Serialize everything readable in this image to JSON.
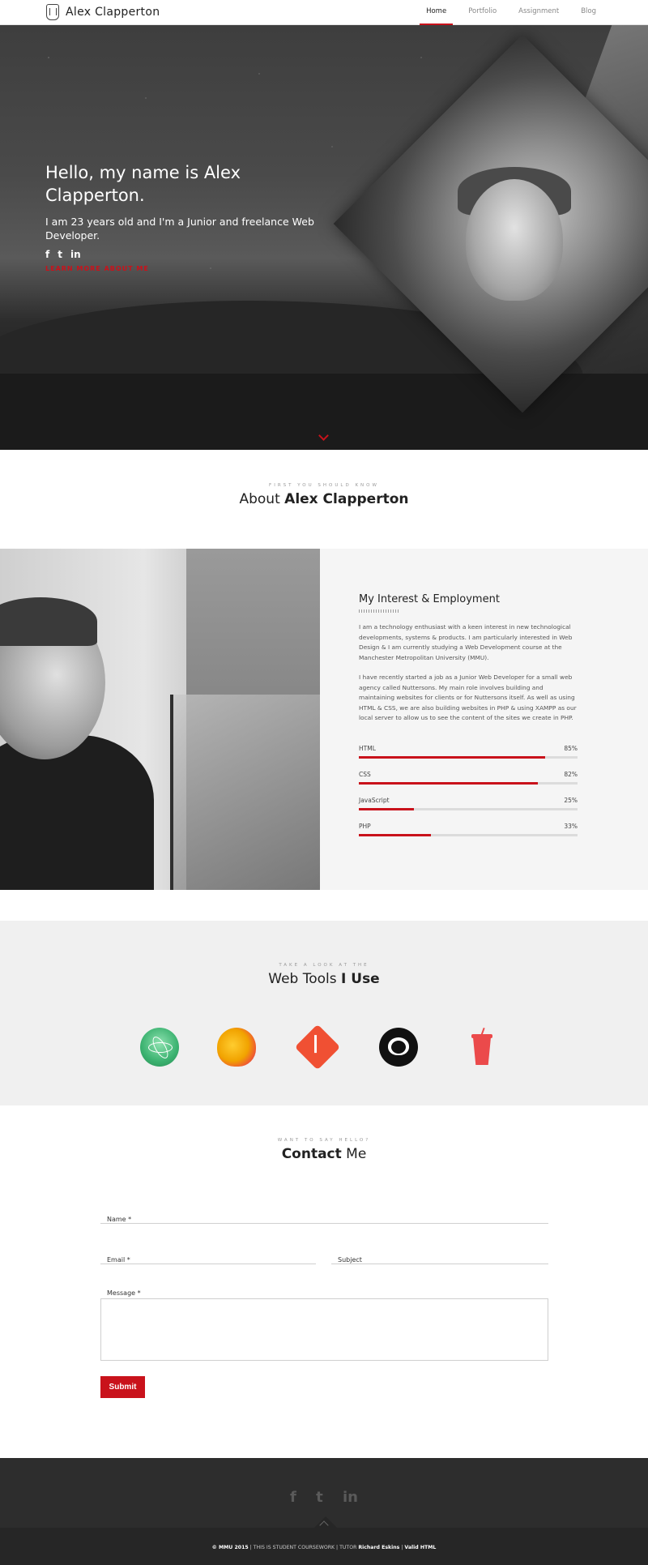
{
  "nav": {
    "logo_text": "Alex Clapperton",
    "links": [
      "Home",
      "Portfolio",
      "Assignment",
      "Blog"
    ],
    "active": "Home"
  },
  "hero": {
    "title": "Hello, my name is Alex Clapperton.",
    "subtitle": "I am 23 years old and I'm a Junior and freelance Web Developer.",
    "social_icons": [
      "facebook-icon",
      "twitter-icon",
      "linkedin-icon"
    ],
    "social_glyphs": [
      "f",
      "t",
      "in"
    ],
    "cta": "LEARN MORE ABOUT ME"
  },
  "about": {
    "kicker": "FIRST YOU SHOULD KNOW",
    "title_light": "About ",
    "title_bold": "Alex Clapperton",
    "info_title": "My Interest & Employment",
    "paragraph1": "I am a technology enthusiast with a keen interest in new technological developments, systems & products. I am particularly interested in Web Design & I am currently studying a Web Development course at the Manchester Metropolitan University (MMU).",
    "paragraph2": "I have recently started a job as a Junior Web Developer for a small web agency called Nuttersons. My main role involves building and maintaining websites for clients or for Nuttersons itself. As well as using HTML & CSS, we are also building websites in PHP & using XAMPP as our local server to allow us to see the content of the sites we create in PHP.",
    "skills": [
      {
        "name": "HTML",
        "percent_label": "85%",
        "value": 0.85
      },
      {
        "name": "CSS",
        "percent_label": "82%",
        "value": 0.82
      },
      {
        "name": "JavaScript",
        "percent_label": "25%",
        "value": 0.25
      },
      {
        "name": "PHP",
        "percent_label": "33%",
        "value": 0.33
      }
    ]
  },
  "tools": {
    "kicker": "TAKE A LOOK AT THE",
    "title_light": "Web Tools ",
    "title_bold": "I Use",
    "icons": [
      "atom-icon",
      "bower-icon",
      "git-icon",
      "github-icon",
      "gulp-icon"
    ]
  },
  "contact": {
    "kicker": "WANT TO SAY HELLO?",
    "title_bold": "Contact",
    "title_light": " Me",
    "name_label": "Name *",
    "email_label": "Email *",
    "subject_label": "Subject",
    "message_label": "Message *",
    "submit_label": "Submit"
  },
  "footer": {
    "social_glyphs": [
      "f",
      "t",
      "in"
    ],
    "text_1": "© MMU 2015",
    "text_2": " | THIS IS STUDENT COURSEWORK | TUTOR ",
    "text_3": "Richard Eskins",
    "text_4": " | ",
    "text_5": "Valid HTML"
  },
  "colors": {
    "accent": "#c9121b",
    "footer_bg": "#2d2d2d",
    "tools_bg": "#f0f0f0",
    "info_bg": "#f5f5f5"
  }
}
